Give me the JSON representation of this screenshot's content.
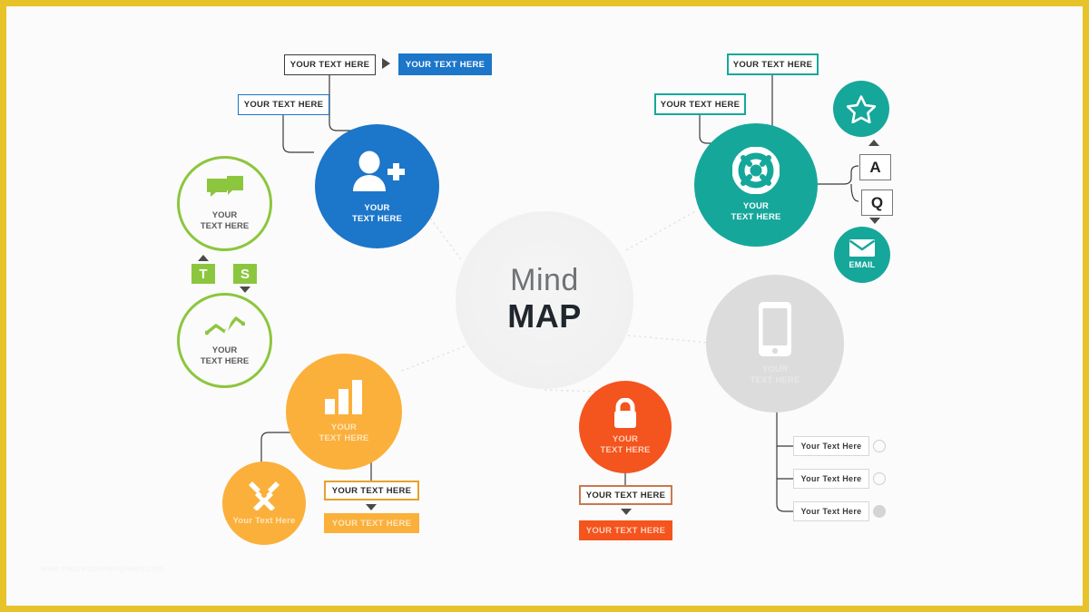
{
  "slide": {
    "frame_color": "#e8c229",
    "background": "#fbfbfb",
    "watermark": "www.thecreativetemplates.com"
  },
  "center": {
    "line1": "Mind",
    "line2": "MAP"
  },
  "palette": {
    "blue": "#1c76c9",
    "teal": "#16a79b",
    "green": "#8cc63e",
    "orange": "#fbb03b",
    "red": "#f4541d",
    "gray": "#dcdcdc",
    "text_dark": "#2b2b2b"
  },
  "branches": {
    "blue": {
      "name": "add-user",
      "icon": "user-plus-icon",
      "color": "#1c76c9",
      "circle_caption": [
        "YOUR",
        "TEXT HERE"
      ],
      "boxes": [
        {
          "label": "YOUR TEXT HERE",
          "style": "outline",
          "border": "#3a3a3a"
        },
        {
          "label": "YOUR TEXT HERE",
          "style": "solid",
          "fill": "#1c76c9"
        },
        {
          "label": "YOUR TEXT HERE",
          "style": "outline",
          "border": "#1c76c9"
        }
      ],
      "arrow": "arrow-right-icon"
    },
    "green": {
      "name": "chat-analytics",
      "color": "#8cc63e",
      "top_circle": {
        "icon": "chat-bubbles-icon",
        "caption": [
          "YOUR",
          "TEXT HERE"
        ]
      },
      "bottom_circle": {
        "icon": "line-chart-icon",
        "caption": [
          "YOUR",
          "TEXT HERE"
        ]
      },
      "badges": [
        {
          "label": "T",
          "fill": "#8cc63e"
        },
        {
          "label": "S",
          "fill": "#8cc63e"
        }
      ],
      "triangles": [
        "triangle-up-icon",
        "triangle-down-icon"
      ]
    },
    "orange": {
      "name": "bar-chart-tools",
      "color": "#fbb03b",
      "main_circle": {
        "icon": "bar-chart-icon",
        "caption": [
          "YOUR",
          "TEXT HERE"
        ]
      },
      "sub_circle": {
        "icon": "tools-icon",
        "caption": "Your Text Here"
      },
      "boxes": [
        {
          "label": "YOUR TEXT HERE",
          "style": "outline",
          "border": "#e8a02b"
        },
        {
          "label": "YOUR TEXT HERE",
          "style": "solid",
          "fill": "#fbb03b"
        }
      ],
      "arrow": "triangle-down-icon"
    },
    "teal": {
      "name": "support",
      "icon": "lifebuoy-icon",
      "color": "#16a79b",
      "circle_caption": [
        "YOUR",
        "TEXT HERE"
      ],
      "boxes": [
        {
          "label": "YOUR TEXT HERE",
          "style": "outline",
          "border": "#16a79b"
        },
        {
          "label": "YOUR TEXT HERE",
          "style": "outline",
          "border": "#16a79b"
        }
      ],
      "star_circle": {
        "icon": "star-icon",
        "fill": "#16a79b"
      },
      "email_circle": {
        "icon": "envelope-icon",
        "fill": "#16a79b",
        "label": "EMAIL"
      },
      "letters": [
        {
          "label": "A"
        },
        {
          "label": "Q"
        }
      ],
      "triangles": [
        "triangle-up-icon",
        "triangle-down-icon"
      ]
    },
    "gray": {
      "name": "mobile",
      "icon": "smartphone-icon",
      "color": "#dcdcdc",
      "circle_caption": [
        "YOUR",
        "TEXT HERE"
      ],
      "items": [
        {
          "label": "Your Text Here",
          "bullet": "empty"
        },
        {
          "label": "Your Text Here",
          "bullet": "empty"
        },
        {
          "label": "Your Text Here",
          "bullet": "filled"
        }
      ]
    },
    "red": {
      "name": "security",
      "icon": "lock-icon",
      "color": "#f4541d",
      "circle_caption": [
        "YOUR",
        "TEXT HERE"
      ],
      "boxes": [
        {
          "label": "YOUR TEXT HERE",
          "style": "outline",
          "border": "#c9794f"
        },
        {
          "label": "YOUR TEXT HERE",
          "style": "solid",
          "fill": "#f4541d"
        }
      ],
      "arrow": "triangle-down-icon"
    }
  }
}
